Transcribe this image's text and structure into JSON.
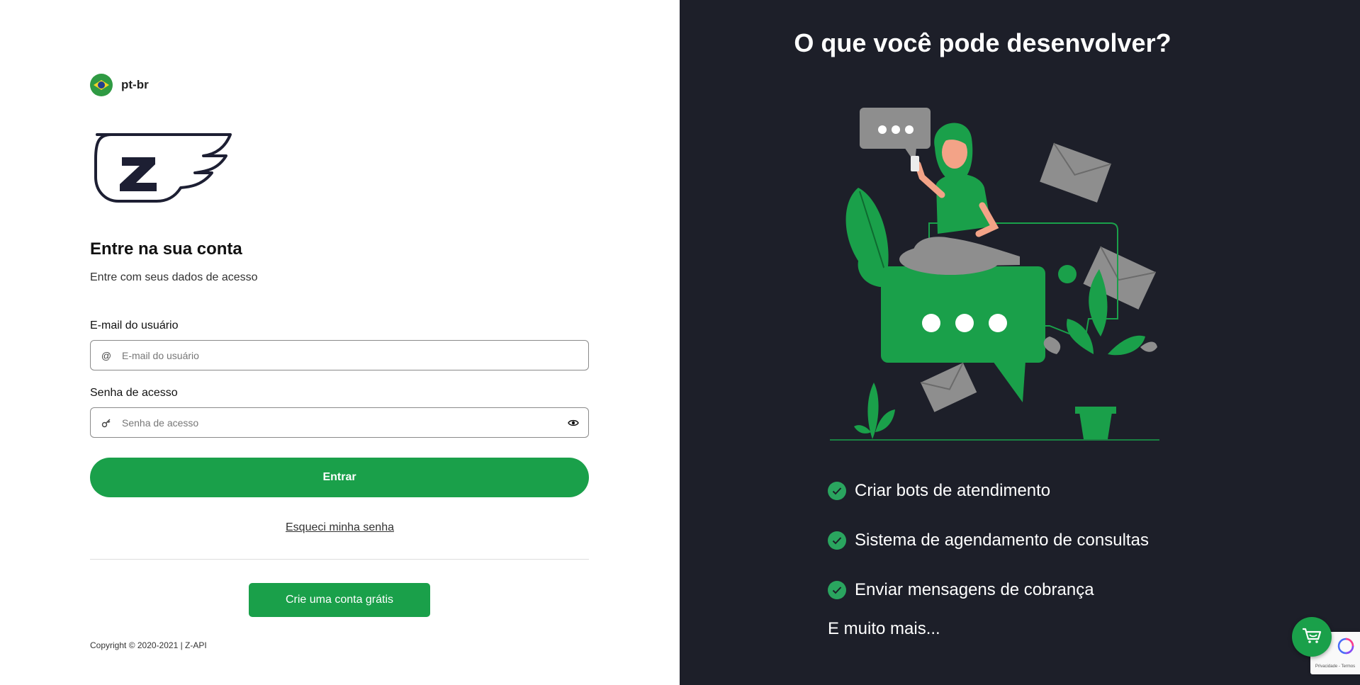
{
  "language": {
    "label": "pt-br",
    "icon": "brazil-flag-icon"
  },
  "login": {
    "heading": "Entre na sua conta",
    "subheading": "Entre com seus dados de acesso",
    "email_label": "E-mail do usuário",
    "email_placeholder": "E-mail do usuário",
    "email_value": "",
    "email_icon": "at-sign-icon",
    "password_label": "Senha de acesso",
    "password_placeholder": "Senha de acesso",
    "password_value": "",
    "password_icon": "key-icon",
    "password_toggle_icon": "eye-icon",
    "submit_label": "Entrar",
    "forgot_label": "Esqueci minha senha",
    "signup_label": "Crie uma conta grátis",
    "copyright": "Copyright © 2020-2021 | Z-API"
  },
  "promo": {
    "title": "O que você pode desenvolver?",
    "features": [
      "Criar bots de atendimento",
      "Sistema de agendamento de consultas",
      "Enviar mensagens de cobrança"
    ],
    "more": "E muito mais..."
  },
  "recaptcha": {
    "text": "Privacidade - Termos"
  },
  "colors": {
    "primary": "#1aa04a",
    "dark_panel": "#1d1f29",
    "logo": "#1d1f33"
  }
}
